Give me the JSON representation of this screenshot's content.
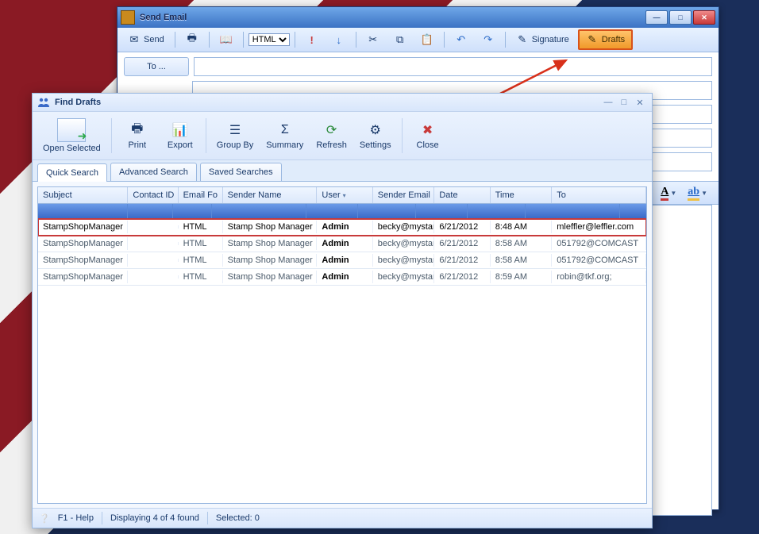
{
  "send_window": {
    "title": "Send Email",
    "toolbar": {
      "send": "Send",
      "format_select": "HTML",
      "signature": "Signature",
      "drafts": "Drafts"
    },
    "compose": {
      "to_button": "To ..."
    },
    "format_bar": {
      "font_color": "A",
      "highlight": "A"
    }
  },
  "drafts_window": {
    "title": "Find Drafts",
    "ribbon": {
      "open_selected": "Open Selected",
      "print": "Print",
      "export": "Export",
      "group_by": "Group By",
      "summary": "Summary",
      "refresh": "Refresh",
      "settings": "Settings",
      "close": "Close"
    },
    "tabs": {
      "quick": "Quick Search",
      "advanced": "Advanced Search",
      "saved": "Saved Searches"
    },
    "columns": {
      "subject": "Subject",
      "contact_id": "Contact ID",
      "email_fo": "Email Fo",
      "sender_name": "Sender Name",
      "user": "User",
      "sender_email": "Sender Email",
      "date": "Date",
      "time": "Time",
      "to": "To"
    },
    "rows": [
      {
        "subject": "StampShopManager",
        "contact_id": "",
        "email_fo": "HTML",
        "sender_name": "Stamp Shop Manager",
        "user": "Admin",
        "sender_email": "becky@mystar",
        "date": "6/21/2012",
        "time": "8:48 AM",
        "to": "mleffler@leffler.com"
      },
      {
        "subject": "StampShopManager",
        "contact_id": "",
        "email_fo": "HTML",
        "sender_name": "Stamp Shop Manager",
        "user": "Admin",
        "sender_email": "becky@mystar",
        "date": "6/21/2012",
        "time": "8:58 AM",
        "to": "051792@COMCAST"
      },
      {
        "subject": "StampShopManager",
        "contact_id": "",
        "email_fo": "HTML",
        "sender_name": "Stamp Shop Manager",
        "user": "Admin",
        "sender_email": "becky@mystar",
        "date": "6/21/2012",
        "time": "8:58 AM",
        "to": "051792@COMCAST"
      },
      {
        "subject": "StampShopManager",
        "contact_id": "",
        "email_fo": "HTML",
        "sender_name": "Stamp Shop Manager",
        "user": "Admin",
        "sender_email": "becky@mystar",
        "date": "6/21/2012",
        "time": "8:59 AM",
        "to": "robin@tkf.org;"
      }
    ],
    "status": {
      "help": "F1 - Help",
      "displaying": "Displaying 4 of 4 found",
      "selected": "Selected: 0"
    }
  }
}
